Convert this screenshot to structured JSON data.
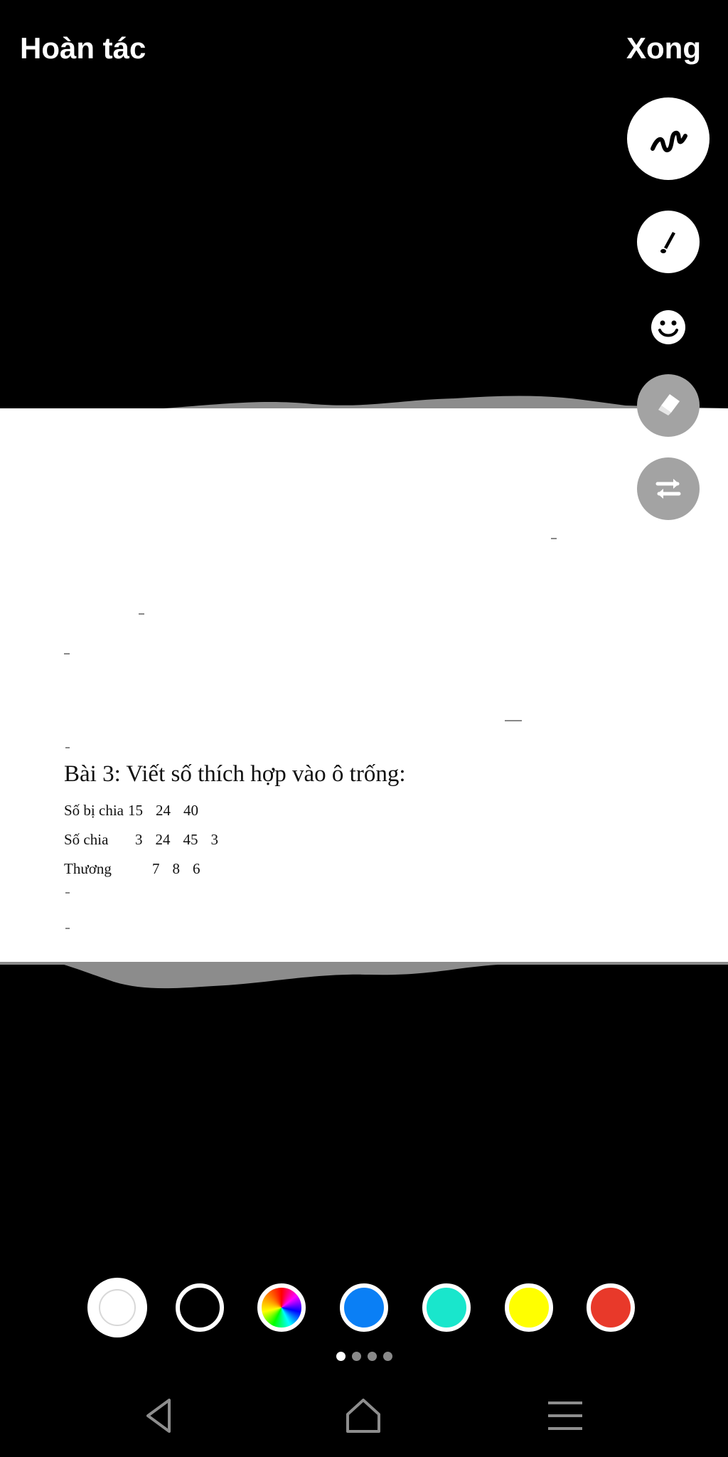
{
  "topbar": {
    "undo_label": "Hoàn tác",
    "done_label": "Xong"
  },
  "tools": [
    {
      "name": "scribble-tool",
      "icon": "scribble-icon"
    },
    {
      "name": "pen-tool",
      "icon": "pen-icon"
    },
    {
      "name": "emoji-tool",
      "icon": "emoji-icon"
    },
    {
      "name": "eraser-tool",
      "icon": "eraser-icon"
    },
    {
      "name": "swap-tool",
      "icon": "swap-icon"
    }
  ],
  "document": {
    "title": "Bài 3: Viết số thích hợp vào ô trống:",
    "rows": [
      {
        "label": "Số bị chia",
        "cells": [
          "15",
          "24",
          "40"
        ]
      },
      {
        "label": "Số chia",
        "cells": [
          "3",
          "24",
          "45",
          "3"
        ]
      },
      {
        "label": "Thương",
        "cells": [
          "",
          "7",
          "8",
          "6"
        ]
      }
    ]
  },
  "palette": {
    "selected": "white",
    "colors": [
      "#ffffff",
      "#000000",
      "rainbow",
      "#0a7ff5",
      "#19e6cc",
      "#ffff00",
      "#e8392a"
    ]
  },
  "page_indicator": {
    "count": 4,
    "active": 1
  },
  "navbar": [
    {
      "name": "back-button",
      "icon": "back-triangle-icon"
    },
    {
      "name": "home-button",
      "icon": "home-icon"
    },
    {
      "name": "menu-button",
      "icon": "menu-icon"
    }
  ]
}
